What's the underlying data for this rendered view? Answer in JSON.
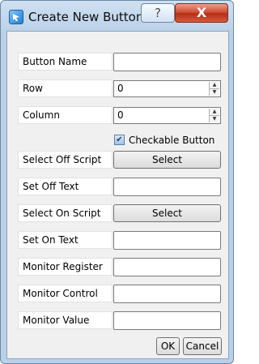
{
  "window": {
    "title": "Create New Button",
    "help_glyph": "?",
    "close_glyph": "X"
  },
  "form": {
    "button_name": {
      "label": "Button Name",
      "value": ""
    },
    "row": {
      "label": "Row",
      "value": "0"
    },
    "column": {
      "label": "Column",
      "value": "0"
    },
    "checkable": {
      "label": "Checkable Button",
      "checked": true,
      "check_glyph": "✔"
    },
    "select_off_script": {
      "label": "Select Off Script",
      "button": "Select"
    },
    "set_off_text": {
      "label": "Set Off Text",
      "value": ""
    },
    "select_on_script": {
      "label": "Select On Script",
      "button": "Select"
    },
    "set_on_text": {
      "label": "Set On Text",
      "value": ""
    },
    "monitor_register": {
      "label": "Monitor Register",
      "value": ""
    },
    "monitor_control": {
      "label": "Monitor Control",
      "value": ""
    },
    "monitor_value": {
      "label": "Monitor Value",
      "value": ""
    }
  },
  "actions": {
    "ok": "OK",
    "cancel": "Cancel"
  },
  "icons": {
    "app": "app-icon",
    "help": "help-icon",
    "close": "close-icon",
    "spin_up": "▲",
    "spin_down": "▼"
  }
}
